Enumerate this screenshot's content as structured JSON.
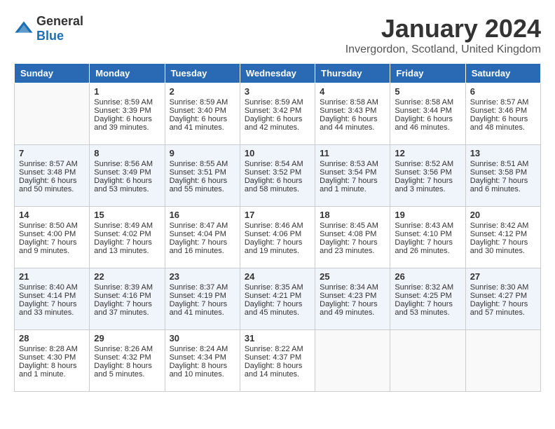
{
  "header": {
    "logo_general": "General",
    "logo_blue": "Blue",
    "month": "January 2024",
    "location": "Invergordon, Scotland, United Kingdom"
  },
  "days_of_week": [
    "Sunday",
    "Monday",
    "Tuesday",
    "Wednesday",
    "Thursday",
    "Friday",
    "Saturday"
  ],
  "weeks": [
    [
      {
        "day": "",
        "sunrise": "",
        "sunset": "",
        "daylight": ""
      },
      {
        "day": "1",
        "sunrise": "Sunrise: 8:59 AM",
        "sunset": "Sunset: 3:39 PM",
        "daylight": "Daylight: 6 hours and 39 minutes."
      },
      {
        "day": "2",
        "sunrise": "Sunrise: 8:59 AM",
        "sunset": "Sunset: 3:40 PM",
        "daylight": "Daylight: 6 hours and 41 minutes."
      },
      {
        "day": "3",
        "sunrise": "Sunrise: 8:59 AM",
        "sunset": "Sunset: 3:42 PM",
        "daylight": "Daylight: 6 hours and 42 minutes."
      },
      {
        "day": "4",
        "sunrise": "Sunrise: 8:58 AM",
        "sunset": "Sunset: 3:43 PM",
        "daylight": "Daylight: 6 hours and 44 minutes."
      },
      {
        "day": "5",
        "sunrise": "Sunrise: 8:58 AM",
        "sunset": "Sunset: 3:44 PM",
        "daylight": "Daylight: 6 hours and 46 minutes."
      },
      {
        "day": "6",
        "sunrise": "Sunrise: 8:57 AM",
        "sunset": "Sunset: 3:46 PM",
        "daylight": "Daylight: 6 hours and 48 minutes."
      }
    ],
    [
      {
        "day": "7",
        "sunrise": "Sunrise: 8:57 AM",
        "sunset": "Sunset: 3:48 PM",
        "daylight": "Daylight: 6 hours and 50 minutes."
      },
      {
        "day": "8",
        "sunrise": "Sunrise: 8:56 AM",
        "sunset": "Sunset: 3:49 PM",
        "daylight": "Daylight: 6 hours and 53 minutes."
      },
      {
        "day": "9",
        "sunrise": "Sunrise: 8:55 AM",
        "sunset": "Sunset: 3:51 PM",
        "daylight": "Daylight: 6 hours and 55 minutes."
      },
      {
        "day": "10",
        "sunrise": "Sunrise: 8:54 AM",
        "sunset": "Sunset: 3:52 PM",
        "daylight": "Daylight: 6 hours and 58 minutes."
      },
      {
        "day": "11",
        "sunrise": "Sunrise: 8:53 AM",
        "sunset": "Sunset: 3:54 PM",
        "daylight": "Daylight: 7 hours and 1 minute."
      },
      {
        "day": "12",
        "sunrise": "Sunrise: 8:52 AM",
        "sunset": "Sunset: 3:56 PM",
        "daylight": "Daylight: 7 hours and 3 minutes."
      },
      {
        "day": "13",
        "sunrise": "Sunrise: 8:51 AM",
        "sunset": "Sunset: 3:58 PM",
        "daylight": "Daylight: 7 hours and 6 minutes."
      }
    ],
    [
      {
        "day": "14",
        "sunrise": "Sunrise: 8:50 AM",
        "sunset": "Sunset: 4:00 PM",
        "daylight": "Daylight: 7 hours and 9 minutes."
      },
      {
        "day": "15",
        "sunrise": "Sunrise: 8:49 AM",
        "sunset": "Sunset: 4:02 PM",
        "daylight": "Daylight: 7 hours and 13 minutes."
      },
      {
        "day": "16",
        "sunrise": "Sunrise: 8:47 AM",
        "sunset": "Sunset: 4:04 PM",
        "daylight": "Daylight: 7 hours and 16 minutes."
      },
      {
        "day": "17",
        "sunrise": "Sunrise: 8:46 AM",
        "sunset": "Sunset: 4:06 PM",
        "daylight": "Daylight: 7 hours and 19 minutes."
      },
      {
        "day": "18",
        "sunrise": "Sunrise: 8:45 AM",
        "sunset": "Sunset: 4:08 PM",
        "daylight": "Daylight: 7 hours and 23 minutes."
      },
      {
        "day": "19",
        "sunrise": "Sunrise: 8:43 AM",
        "sunset": "Sunset: 4:10 PM",
        "daylight": "Daylight: 7 hours and 26 minutes."
      },
      {
        "day": "20",
        "sunrise": "Sunrise: 8:42 AM",
        "sunset": "Sunset: 4:12 PM",
        "daylight": "Daylight: 7 hours and 30 minutes."
      }
    ],
    [
      {
        "day": "21",
        "sunrise": "Sunrise: 8:40 AM",
        "sunset": "Sunset: 4:14 PM",
        "daylight": "Daylight: 7 hours and 33 minutes."
      },
      {
        "day": "22",
        "sunrise": "Sunrise: 8:39 AM",
        "sunset": "Sunset: 4:16 PM",
        "daylight": "Daylight: 7 hours and 37 minutes."
      },
      {
        "day": "23",
        "sunrise": "Sunrise: 8:37 AM",
        "sunset": "Sunset: 4:19 PM",
        "daylight": "Daylight: 7 hours and 41 minutes."
      },
      {
        "day": "24",
        "sunrise": "Sunrise: 8:35 AM",
        "sunset": "Sunset: 4:21 PM",
        "daylight": "Daylight: 7 hours and 45 minutes."
      },
      {
        "day": "25",
        "sunrise": "Sunrise: 8:34 AM",
        "sunset": "Sunset: 4:23 PM",
        "daylight": "Daylight: 7 hours and 49 minutes."
      },
      {
        "day": "26",
        "sunrise": "Sunrise: 8:32 AM",
        "sunset": "Sunset: 4:25 PM",
        "daylight": "Daylight: 7 hours and 53 minutes."
      },
      {
        "day": "27",
        "sunrise": "Sunrise: 8:30 AM",
        "sunset": "Sunset: 4:27 PM",
        "daylight": "Daylight: 7 hours and 57 minutes."
      }
    ],
    [
      {
        "day": "28",
        "sunrise": "Sunrise: 8:28 AM",
        "sunset": "Sunset: 4:30 PM",
        "daylight": "Daylight: 8 hours and 1 minute."
      },
      {
        "day": "29",
        "sunrise": "Sunrise: 8:26 AM",
        "sunset": "Sunset: 4:32 PM",
        "daylight": "Daylight: 8 hours and 5 minutes."
      },
      {
        "day": "30",
        "sunrise": "Sunrise: 8:24 AM",
        "sunset": "Sunset: 4:34 PM",
        "daylight": "Daylight: 8 hours and 10 minutes."
      },
      {
        "day": "31",
        "sunrise": "Sunrise: 8:22 AM",
        "sunset": "Sunset: 4:37 PM",
        "daylight": "Daylight: 8 hours and 14 minutes."
      },
      {
        "day": "",
        "sunrise": "",
        "sunset": "",
        "daylight": ""
      },
      {
        "day": "",
        "sunrise": "",
        "sunset": "",
        "daylight": ""
      },
      {
        "day": "",
        "sunrise": "",
        "sunset": "",
        "daylight": ""
      }
    ]
  ]
}
